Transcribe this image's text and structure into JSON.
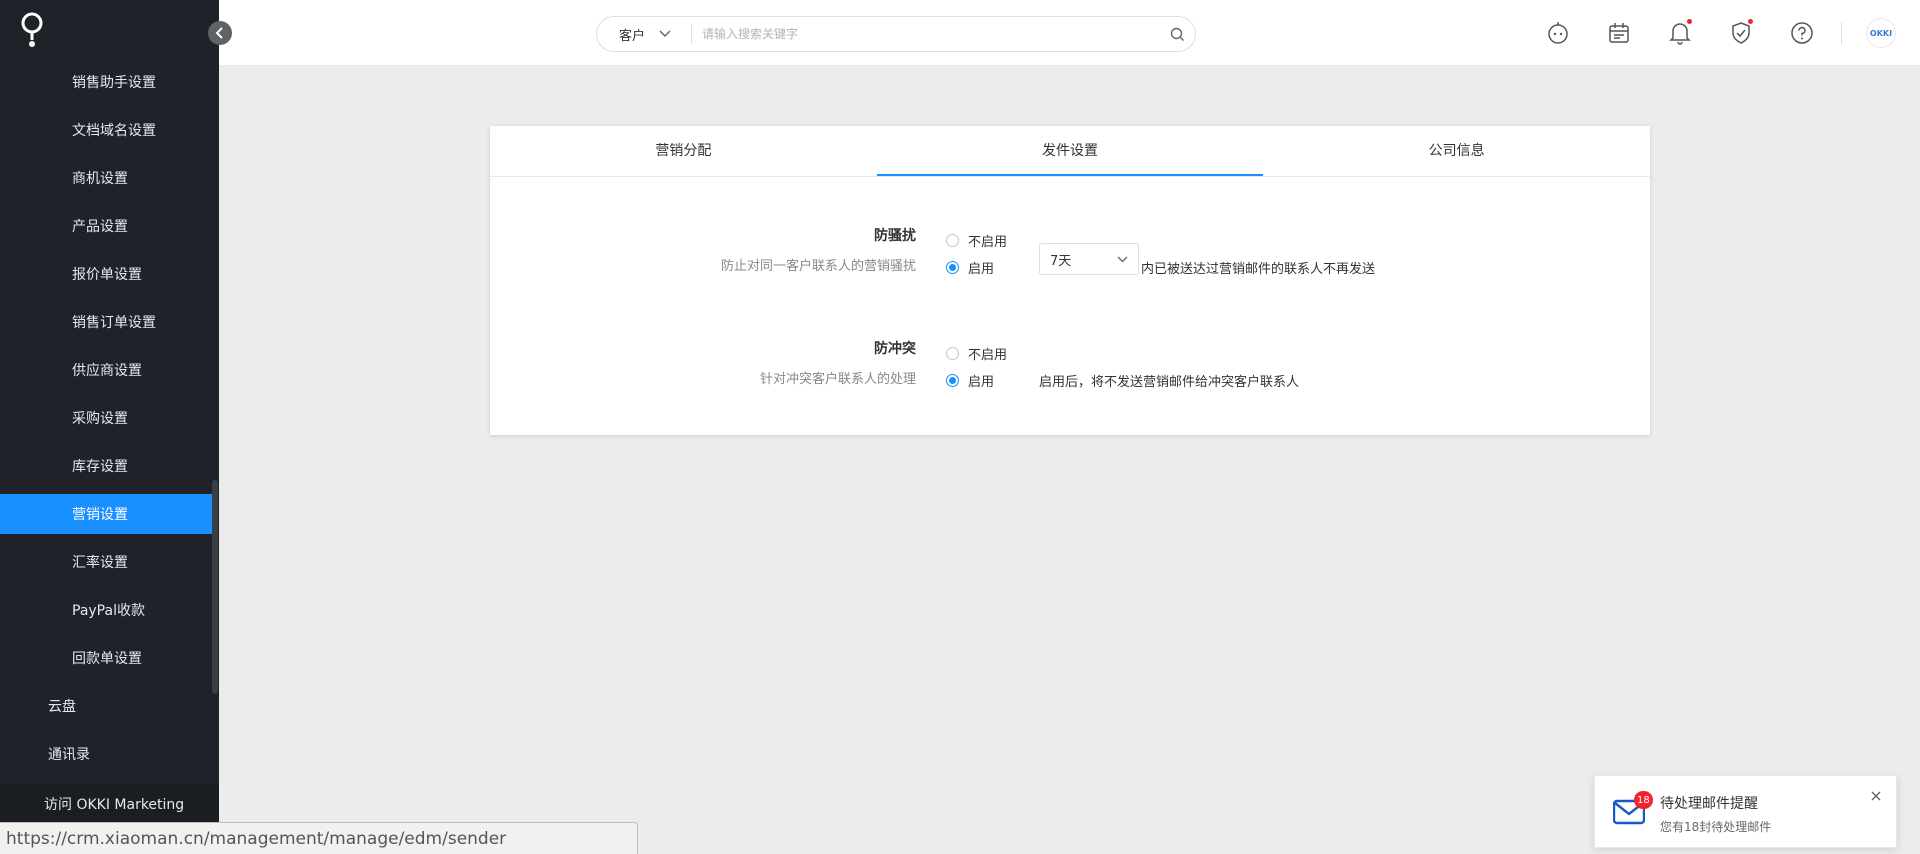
{
  "sidebar": {
    "items": [
      {
        "label": "销售助手设置",
        "active": false
      },
      {
        "label": "文档域名设置",
        "active": false
      },
      {
        "label": "商机设置",
        "active": false
      },
      {
        "label": "产品设置",
        "active": false
      },
      {
        "label": "报价单设置",
        "active": false
      },
      {
        "label": "销售订单设置",
        "active": false
      },
      {
        "label": "供应商设置",
        "active": false
      },
      {
        "label": "采购设置",
        "active": false
      },
      {
        "label": "库存设置",
        "active": false
      },
      {
        "label": "营销设置",
        "active": true
      },
      {
        "label": "汇率设置",
        "active": false
      },
      {
        "label": "PayPal收款",
        "active": false
      },
      {
        "label": "回款单设置",
        "active": false
      }
    ],
    "top_items": [
      {
        "label": "云盘"
      },
      {
        "label": "通讯录"
      }
    ],
    "visit_link": "访问 OKKI Marketing"
  },
  "header": {
    "search_type": "客户",
    "search_placeholder": "请输入搜索关键字",
    "avatar_text": "OKKI"
  },
  "tabs": [
    {
      "label": "营销分配",
      "active": false
    },
    {
      "label": "发件设置",
      "active": true
    },
    {
      "label": "公司信息",
      "active": false
    }
  ],
  "anti_harass": {
    "title": "防骚扰",
    "desc": "防止对同一客户联系人的营销骚扰",
    "option_disable": "不启用",
    "option_enable": "启用",
    "selected": "enable",
    "days_value": "7天",
    "suffix_text": "内已被送达过营销邮件的联系人不再发送"
  },
  "anti_conflict": {
    "title": "防冲突",
    "desc": "针对冲突客户联系人的处理",
    "option_disable": "不启用",
    "option_enable": "启用",
    "selected": "enable",
    "note_text": "启用后，将不发送营销邮件给冲突客户联系人"
  },
  "notification": {
    "badge": "18",
    "title": "待处理邮件提醒",
    "subtitle": "您有18封待处理邮件"
  },
  "status_url": "https://crm.xiaoman.cn/management/manage/edm/sender",
  "colors": {
    "accent": "#1890ff",
    "sidebar_bg": "#1f2329",
    "badge_red": "#f5222d"
  }
}
